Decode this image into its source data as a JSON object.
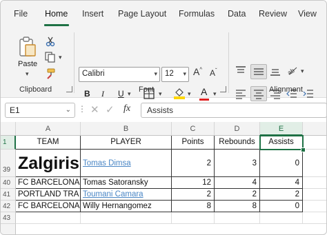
{
  "ribbon_tabs": [
    "File",
    "Home",
    "Insert",
    "Page Layout",
    "Formulas",
    "Data",
    "Review",
    "View"
  ],
  "clipboard": {
    "paste_label": "Paste",
    "group_label": "Clipboard"
  },
  "font": {
    "name": "Calibri",
    "size": "12",
    "bold": "B",
    "italic": "I",
    "underline": "U",
    "group_label": "Font"
  },
  "alignment": {
    "group_label": "Alignment"
  },
  "formula_bar": {
    "name_box": "E1",
    "fx": "fx",
    "content": "Assists"
  },
  "columns": [
    "A",
    "B",
    "C",
    "D",
    "E"
  ],
  "rows": [
    {
      "num": "1",
      "team": "TEAM",
      "player": "PLAYER",
      "points": "Points",
      "rebounds": "Rebounds",
      "assists": "Assists"
    },
    {
      "num": "39",
      "team": "Zalgiris",
      "player": "Tomas Dimsa",
      "points": "2",
      "rebounds": "3",
      "assists": "0"
    },
    {
      "num": "40",
      "team": "FC BARCELONA",
      "player": "Tomas Satoransky",
      "points": "12",
      "rebounds": "4",
      "assists": "4"
    },
    {
      "num": "41",
      "team": "PORTLAND TRA",
      "player": "Toumani Camara",
      "points": "2",
      "rebounds": "2",
      "assists": "2"
    },
    {
      "num": "42",
      "team": "FC BARCELONA",
      "player": "Willy Hernangomez",
      "points": "8",
      "rebounds": "8",
      "assists": "0"
    },
    {
      "num": "43",
      "team": "",
      "player": "",
      "points": "",
      "rebounds": "",
      "assists": ""
    }
  ],
  "colors": {
    "accent": "#1e7145",
    "link": "#4a86c5",
    "fill_yellow": "#ffd700",
    "font_red": "#e02020"
  }
}
